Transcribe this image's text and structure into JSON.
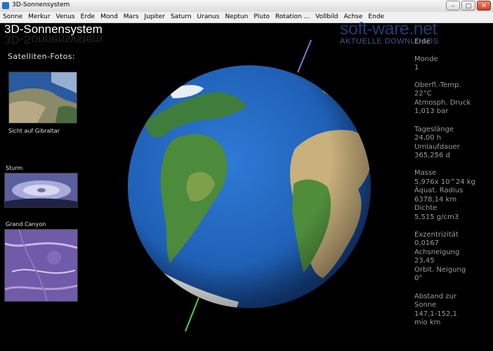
{
  "window": {
    "title": "3D-Sonnensystem",
    "min_icon": "minimize-icon",
    "max_icon": "maximize-icon",
    "close_icon": "close-icon"
  },
  "menu": [
    "Sonne",
    "Merkur",
    "Venus",
    "Erde",
    "Mond",
    "Mars",
    "Jupiter",
    "Saturn",
    "Uranus",
    "Neptun",
    "Pluto",
    "Rotation ...",
    "Vollbild",
    "Achse",
    "Ende"
  ],
  "app_title": "3D-Sonnensystem",
  "watermark": {
    "name": "soft-ware.net",
    "tagline": "AKTUELLE DOWNLOADS"
  },
  "satellite": {
    "heading": "Satelliten-Fotos:",
    "photos": [
      {
        "caption": "Sicht auf Gibraltar"
      },
      {
        "caption": "Sturm"
      },
      {
        "caption": "Grand Canyon"
      }
    ]
  },
  "planet_info": {
    "name": "Erde",
    "moons_label": "Monde",
    "moons": "1",
    "temp_label": "Oberfl.-Temp.",
    "temp": "22°C",
    "pressure_label": "Atmosph. Druck",
    "pressure": "1,013 bar",
    "day_label": "Tageslänge",
    "day": "24,00 h",
    "orbit_label": "Umlaufdauer",
    "orbit": "365,256 d",
    "mass_label": "Masse",
    "mass": "5,976x 10^24 kg",
    "radius_label": "Äquat. Radius",
    "radius": "6378,14 km",
    "density_label": "Dichte",
    "density": "5,515 g/cm3",
    "ecc_label": "Exzentrizität",
    "ecc": "0,0167",
    "tilt_label": "Achsneigung",
    "tilt": "23,45",
    "incl_label": "Orbit. Neigung",
    "incl": "0°",
    "dist_label_1": "Abstand zur",
    "dist_label_2": "Sonne",
    "dist_1": "147,1-152,1",
    "dist_2": "mio km"
  },
  "colors": {
    "background": "#000000",
    "text_info": "#9a9a9a",
    "axis_north": "#8f6fd6",
    "axis_south": "#46d13f",
    "ocean": "#1f5fb5"
  }
}
